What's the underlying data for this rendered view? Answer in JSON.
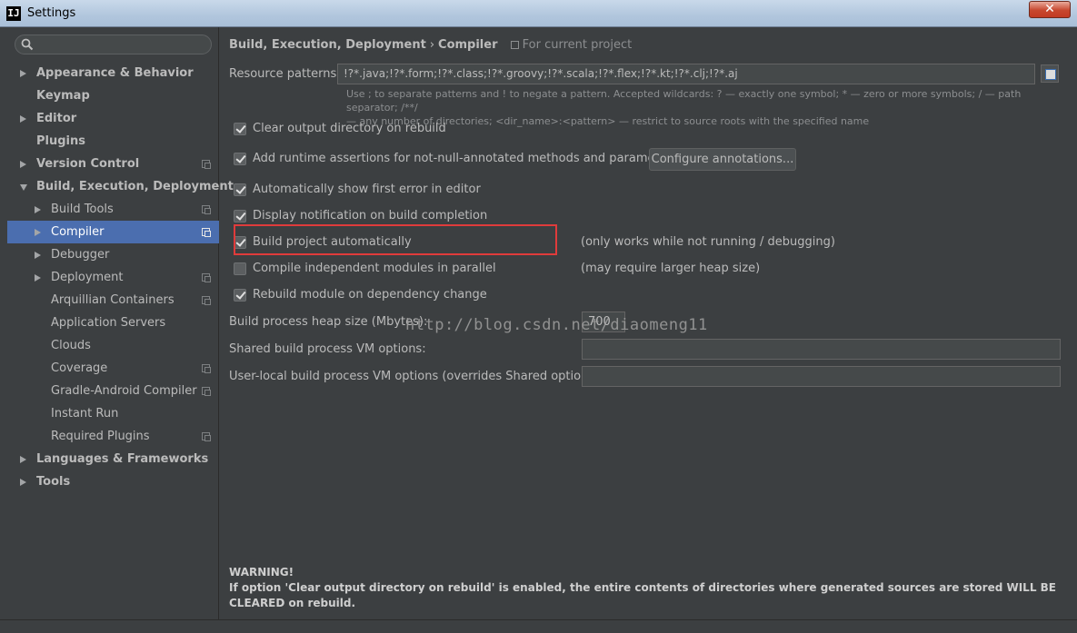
{
  "window": {
    "title": "Settings",
    "logo": "IJ",
    "close_glyph": "✕"
  },
  "search": {
    "placeholder": ""
  },
  "sidebar": {
    "items": [
      {
        "label": "Appearance & Behavior",
        "level": 0,
        "expander": "collapsed",
        "project_icon": false
      },
      {
        "label": "Keymap",
        "level": 0,
        "expander": "none",
        "project_icon": false
      },
      {
        "label": "Editor",
        "level": 0,
        "expander": "collapsed",
        "project_icon": false
      },
      {
        "label": "Plugins",
        "level": 0,
        "expander": "none",
        "project_icon": false
      },
      {
        "label": "Version Control",
        "level": 0,
        "expander": "collapsed",
        "project_icon": true
      },
      {
        "label": "Build, Execution, Deployment",
        "level": 0,
        "expander": "expanded",
        "project_icon": false
      },
      {
        "label": "Build Tools",
        "level": 1,
        "expander": "collapsed",
        "project_icon": true
      },
      {
        "label": "Compiler",
        "level": 1,
        "expander": "collapsed",
        "project_icon": true,
        "selected": true
      },
      {
        "label": "Debugger",
        "level": 1,
        "expander": "collapsed",
        "project_icon": false
      },
      {
        "label": "Deployment",
        "level": 1,
        "expander": "collapsed",
        "project_icon": true
      },
      {
        "label": "Arquillian Containers",
        "level": 1,
        "expander": "none",
        "project_icon": true
      },
      {
        "label": "Application Servers",
        "level": 1,
        "expander": "none",
        "project_icon": false
      },
      {
        "label": "Clouds",
        "level": 1,
        "expander": "none",
        "project_icon": false
      },
      {
        "label": "Coverage",
        "level": 1,
        "expander": "none",
        "project_icon": true
      },
      {
        "label": "Gradle-Android Compiler",
        "level": 1,
        "expander": "none",
        "project_icon": true
      },
      {
        "label": "Instant Run",
        "level": 1,
        "expander": "none",
        "project_icon": false
      },
      {
        "label": "Required Plugins",
        "level": 1,
        "expander": "none",
        "project_icon": true
      },
      {
        "label": "Languages & Frameworks",
        "level": 0,
        "expander": "collapsed",
        "project_icon": false
      },
      {
        "label": "Tools",
        "level": 0,
        "expander": "collapsed",
        "project_icon": false
      }
    ]
  },
  "breadcrumb": {
    "parent": "Build, Execution, Deployment",
    "separator": "›",
    "current": "Compiler",
    "scope": "For current project"
  },
  "resource_patterns": {
    "label": "Resource patterns:",
    "value": "!?*.java;!?*.form;!?*.class;!?*.groovy;!?*.scala;!?*.flex;!?*.kt;!?*.clj;!?*.aj",
    "hint_line1": "Use ; to separate patterns and ! to negate a pattern. Accepted wildcards: ? — exactly one symbol; * — zero or more symbols; / — path separator; /**/",
    "hint_line2": "— any number of directories; <dir_name>:<pattern> — restrict to source roots with the specified name"
  },
  "options": [
    {
      "label": "Clear output directory on rebuild",
      "checked": true
    },
    {
      "label": "Add runtime assertions for not-null-annotated methods and parameters",
      "checked": true
    },
    {
      "label": "Automatically show first error in editor",
      "checked": true
    },
    {
      "label": "Display notification on build completion",
      "checked": true
    },
    {
      "label": "Build project automatically",
      "checked": true
    },
    {
      "label": "Compile independent modules in parallel",
      "checked": false
    },
    {
      "label": "Rebuild module on dependency change",
      "checked": true
    }
  ],
  "configure_button": "Configure annotations...",
  "notes": {
    "build_auto": "(only works while not running / debugging)",
    "parallel": "(may require larger heap size)"
  },
  "heap": {
    "label": "Build process heap size (Mbytes):",
    "value": "700"
  },
  "shared_vm": {
    "label": "Shared build process VM options:",
    "value": ""
  },
  "user_vm": {
    "label": "User-local build process VM options (overrides Shared options):",
    "value": ""
  },
  "watermark": "http://blog.csdn.net/diaomeng11",
  "warning": {
    "title": "WARNING!",
    "text": "If option 'Clear output directory on rebuild' is enabled, the entire contents of directories where generated sources are stored WILL BE CLEARED on rebuild."
  },
  "colors": {
    "selection": "#4b6eaf",
    "highlight_box": "#e03b3b",
    "background": "#3c3f41"
  }
}
